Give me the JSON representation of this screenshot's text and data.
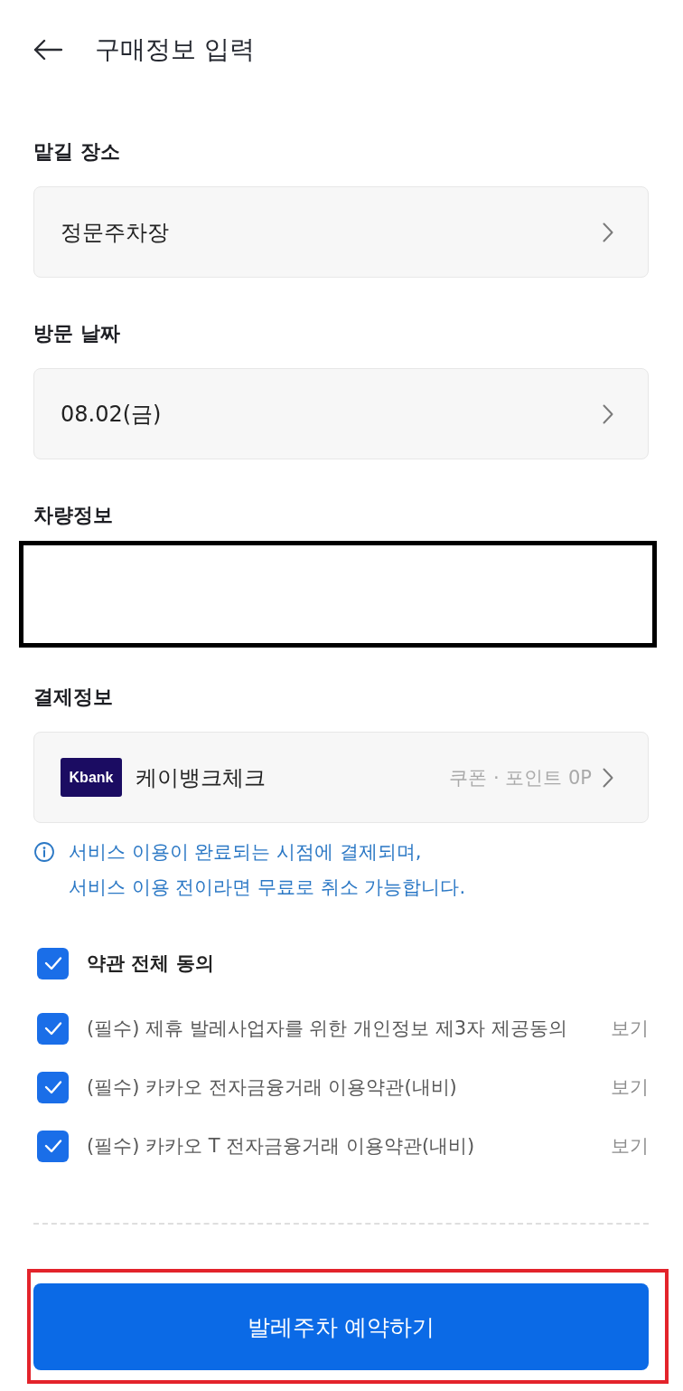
{
  "header": {
    "title": "구매정보 입력"
  },
  "sections": [
    {
      "kind": "select",
      "label": "맡길 장소",
      "value": "정문주차장"
    },
    {
      "kind": "select",
      "label": "방문 날짜",
      "value": "08.02(금)"
    },
    {
      "kind": "redacted",
      "label": "차량정보"
    },
    {
      "kind": "payment",
      "label": "결제정보",
      "card": {
        "logo": "Kbank",
        "name": "케이뱅크체크"
      },
      "benefit": "쿠폰 · 포인트 0P",
      "notice": [
        "서비스 이용이 완료되는 시점에 결제되며,",
        "서비스 이용 전이라면 무료로 취소 가능합니다."
      ]
    }
  ],
  "agreement": {
    "all": {
      "label": "약관 전체 동의",
      "checked": true
    },
    "items": [
      {
        "label": "(필수) 제휴 발레사업자를 위한 개인정보 제3자 제공동의",
        "checked": true,
        "link": "보기"
      },
      {
        "label": "(필수) 카카오 전자금융거래 이용약관(내비)",
        "checked": true,
        "link": "보기"
      },
      {
        "label": "(필수) 카카오 T 전자금융거래 이용약관(내비)",
        "checked": true,
        "link": "보기"
      }
    ]
  },
  "submit": {
    "label": "발레주차 예약하기",
    "highlighted": true
  }
}
